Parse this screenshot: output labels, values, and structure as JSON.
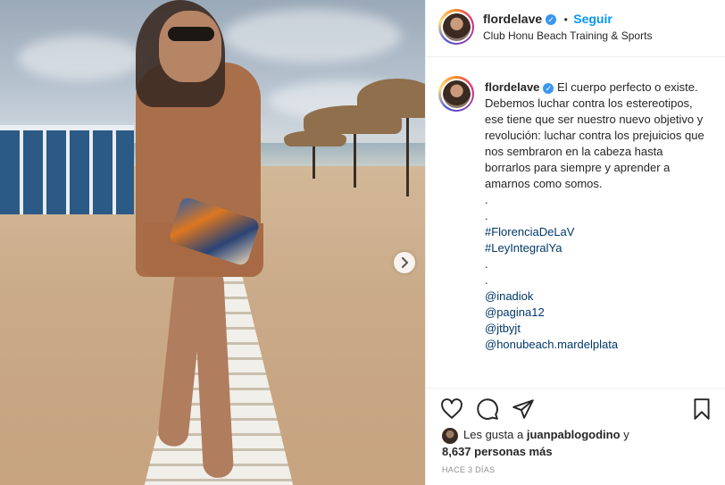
{
  "post": {
    "image_alt": "Woman in a tan mini dress walking on a beach boardwalk with cabanas and umbrellas",
    "next_button_icon": "chevron-right-icon"
  },
  "header": {
    "username": "flordelave",
    "verified_icon": "verified-badge-icon",
    "separator": "•",
    "follow_label": "Seguir",
    "location": "Club Honu Beach Training & Sports"
  },
  "caption": {
    "username": "flordelave",
    "text": "El cuerpo perfecto o existe. Debemos luchar contra los estereotipos, ese tiene que ser nuestro nuevo objetivo y revolución: luchar contra los prejuicios que nos sembraron en la cabeza hasta borrarlos para siempre y aprender a amarnos como somos.",
    "dot1": ".",
    "dot2": ".",
    "hashtags": [
      "#FlorenciaDeLaV",
      "#LeyIntegralYa"
    ],
    "dot3": ".",
    "dot4": ".",
    "mentions": [
      "@inadiok",
      "@pagina12",
      "@jtbyjt",
      "@honubeach.mardelplata"
    ]
  },
  "actions": {
    "like_icon": "heart-icon",
    "comment_icon": "comment-icon",
    "share_icon": "paper-plane-icon",
    "save_icon": "bookmark-icon"
  },
  "likes": {
    "prefix": "Les gusta a",
    "user": "juanpablogodino",
    "conjunction": "y",
    "count": "8,637 personas más"
  },
  "timestamp": "HACE 3 DÍAS",
  "colors": {
    "link_blue": "#0095f6",
    "hashtag": "#00376b",
    "verified": "#3897f0",
    "muted": "#8e8e8e"
  }
}
